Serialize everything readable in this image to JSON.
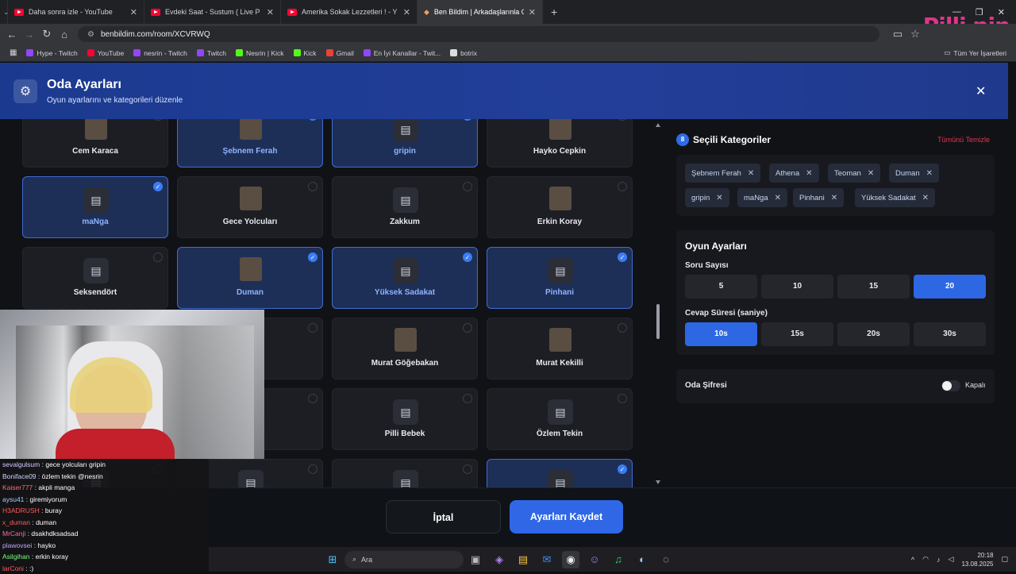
{
  "browser": {
    "tabs": [
      {
        "title": "Daha sonra izle - YouTube",
        "icon": "youtube-icon"
      },
      {
        "title": "Evdeki Saat - Sustum ( Live Perf",
        "icon": "youtube-icon"
      },
      {
        "title": "Amerika Sokak Lezzetleri ! - Yo",
        "icon": "youtube-icon"
      },
      {
        "title": "Ben Bildim | Arkadaşlarınla Onl",
        "icon": "site-icon",
        "active": true
      }
    ],
    "new_tab": "+",
    "url": "benbildim.com/room/XCVRWQ",
    "bookmarks": [
      {
        "label": "Hype - Twitch",
        "color": "#9146ff"
      },
      {
        "label": "YouTube",
        "color": "#ff0033"
      },
      {
        "label": "nesrin - Twitch",
        "color": "#9146ff"
      },
      {
        "label": "Twitch",
        "color": "#9146ff"
      },
      {
        "label": "Nesrin | Kick",
        "color": "#53fc18"
      },
      {
        "label": "Kick",
        "color": "#53fc18"
      },
      {
        "label": "Gmail",
        "color": "#ea4335"
      },
      {
        "label": "En İyi Kanallar - Twit...",
        "color": "#9146ff"
      },
      {
        "label": "botrix",
        "color": "#dddddd"
      }
    ],
    "all_bookmarks": "Tüm Yer İşaretleri",
    "overlay_logo": "Pilli pin"
  },
  "modal": {
    "title": "Oda Ayarları",
    "subtitle": "Oyun ayarlarını ve kategorileri düzenle",
    "close": "✕",
    "categories": [
      {
        "name": "Cem Karaca",
        "selected": false,
        "image": true
      },
      {
        "name": "Şebnem Ferah",
        "selected": true,
        "image": true
      },
      {
        "name": "gripin",
        "selected": true,
        "image": false
      },
      {
        "name": "Hayko Cepkin",
        "selected": false,
        "image": true
      },
      {
        "name": "maNga",
        "selected": true,
        "image": false
      },
      {
        "name": "Gece Yolcuları",
        "selected": false,
        "image": true
      },
      {
        "name": "Zakkum",
        "selected": false,
        "image": false
      },
      {
        "name": "Erkin Koray",
        "selected": false,
        "image": true
      },
      {
        "name": "Seksendört",
        "selected": false,
        "image": false
      },
      {
        "name": "Duman",
        "selected": true,
        "image": true
      },
      {
        "name": "Yüksek Sadakat",
        "selected": true,
        "image": false
      },
      {
        "name": "Pinhani",
        "selected": true,
        "image": false
      },
      {
        "name": "",
        "selected": true,
        "image": false
      },
      {
        "name": "",
        "selected": false,
        "image": false
      },
      {
        "name": "Murat Göğebakan",
        "selected": false,
        "image": true
      },
      {
        "name": "Murat Kekilli",
        "selected": false,
        "image": true
      },
      {
        "name": "",
        "selected": false,
        "image": false
      },
      {
        "name": "",
        "selected": false,
        "image": false
      },
      {
        "name": "Pilli Bebek",
        "selected": false,
        "image": false
      },
      {
        "name": "Özlem Tekin",
        "selected": false,
        "image": false
      },
      {
        "name": "",
        "selected": false,
        "image": false
      },
      {
        "name": "",
        "selected": false,
        "image": false
      },
      {
        "name": "",
        "selected": false,
        "image": false
      },
      {
        "name": "",
        "selected": true,
        "image": false
      }
    ],
    "selected_panel": {
      "count": "8",
      "title": "Seçili Kategoriler",
      "clear_all": "Tümünü Temizle",
      "chips": [
        "Şebnem Ferah",
        "Athena",
        "Teoman",
        "Duman",
        "gripin",
        "maNga",
        "Pinhani",
        "Yüksek Sadakat"
      ]
    },
    "game_settings": {
      "title": "Oyun Ayarları",
      "question_count_label": "Soru Sayısı",
      "question_counts": [
        "5",
        "10",
        "15",
        "20"
      ],
      "question_count_selected": "20",
      "answer_time_label": "Cevap Süresi (saniye)",
      "answer_times": [
        "10s",
        "15s",
        "20s",
        "30s"
      ],
      "answer_time_selected": "10s"
    },
    "password": {
      "label": "Oda Şifresi",
      "state": "Kapalı",
      "enabled": false
    },
    "cancel": "İptal",
    "save": "Ayarları Kaydet"
  },
  "chat": [
    {
      "user": "sevalgulsum",
      "msg": "gece yolcuları gripin",
      "color": "#d8c8ff"
    },
    {
      "user": "Boniface09",
      "msg": "özlem tekin @nesrin",
      "color": "#cfd8ff"
    },
    {
      "user": "Kaiser777",
      "msg": "akpli manga",
      "color": "#ff6b6b"
    },
    {
      "user": "aysu41",
      "msg": "giremiyorum",
      "color": "#a7c7ff"
    },
    {
      "user": "H3ADRUSH",
      "msg": "buray",
      "color": "#ff5b5b"
    },
    {
      "user": "x_duman",
      "msg": "duman",
      "color": "#ff5b5b"
    },
    {
      "user": "MrCanji",
      "msg": "dsakhdksadsad",
      "color": "#ff6b9a"
    },
    {
      "user": "plawovsei",
      "msg": "hayko",
      "color": "#bfa8ff"
    },
    {
      "user": "Asilgihan",
      "msg": "erkin koray",
      "color": "#7cff7c"
    },
    {
      "user": "larConi",
      "msg": ":)",
      "color": "#ff5b5b"
    }
  ],
  "taskbar": {
    "search": "Ara",
    "time": "20:18",
    "date": "13.08.2025"
  }
}
